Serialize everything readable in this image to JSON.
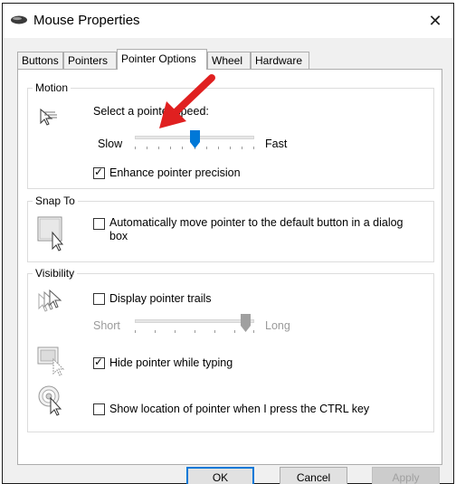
{
  "window": {
    "title": "Mouse Properties",
    "close_glyph": "✕"
  },
  "tabs": [
    {
      "label": "Buttons"
    },
    {
      "label": "Pointers"
    },
    {
      "label": "Pointer Options",
      "active": true
    },
    {
      "label": "Wheel"
    },
    {
      "label": "Hardware"
    }
  ],
  "motion": {
    "label": "Motion",
    "speed_label": "Select a pointer speed:",
    "slow_label": "Slow",
    "fast_label": "Fast",
    "speed_value_fraction": 0.5,
    "enhance_label": "Enhance pointer precision",
    "enhance_checked": true
  },
  "snap_to": {
    "label": "Snap To",
    "auto_move_label_line1": "Automatically move pointer to the default button in a dialog",
    "auto_move_label_line2": "box",
    "auto_move_checked": false
  },
  "visibility": {
    "label": "Visibility",
    "trails_label": "Display pointer trails",
    "trails_checked": false,
    "short_label": "Short",
    "long_label": "Long",
    "trails_value_fraction": 1.0,
    "hide_label": "Hide pointer while typing",
    "hide_checked": true,
    "ctrl_label": "Show location of pointer when I press the CTRL key",
    "ctrl_checked": false
  },
  "buttons": {
    "ok": "OK",
    "cancel": "Cancel",
    "apply": "Apply"
  },
  "colors": {
    "accent": "#0078d7",
    "annotation_arrow": "#e02020"
  },
  "annotation": {
    "icon": "red-arrow-icon"
  }
}
